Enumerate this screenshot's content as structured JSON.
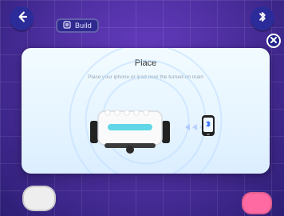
{
  "topbar": {
    "build_label": "Build"
  },
  "modal": {
    "title": "Place",
    "subtitle": "Place your iphone or ipad near the turned-on main"
  },
  "icons": {
    "back": "back-arrow-icon",
    "bluetooth": "bluetooth-icon",
    "close": "close-icon",
    "robot": "robot-icon",
    "phone": "phone-icon",
    "signal": "signal-waves-icon"
  },
  "colors": {
    "background": "#4b2d9a",
    "button": "#23238a",
    "modal_top": "#f2fbff",
    "modal_bottom": "#dbeeff",
    "ring": "#bedcff",
    "robot_accent": "#61d6e6"
  }
}
